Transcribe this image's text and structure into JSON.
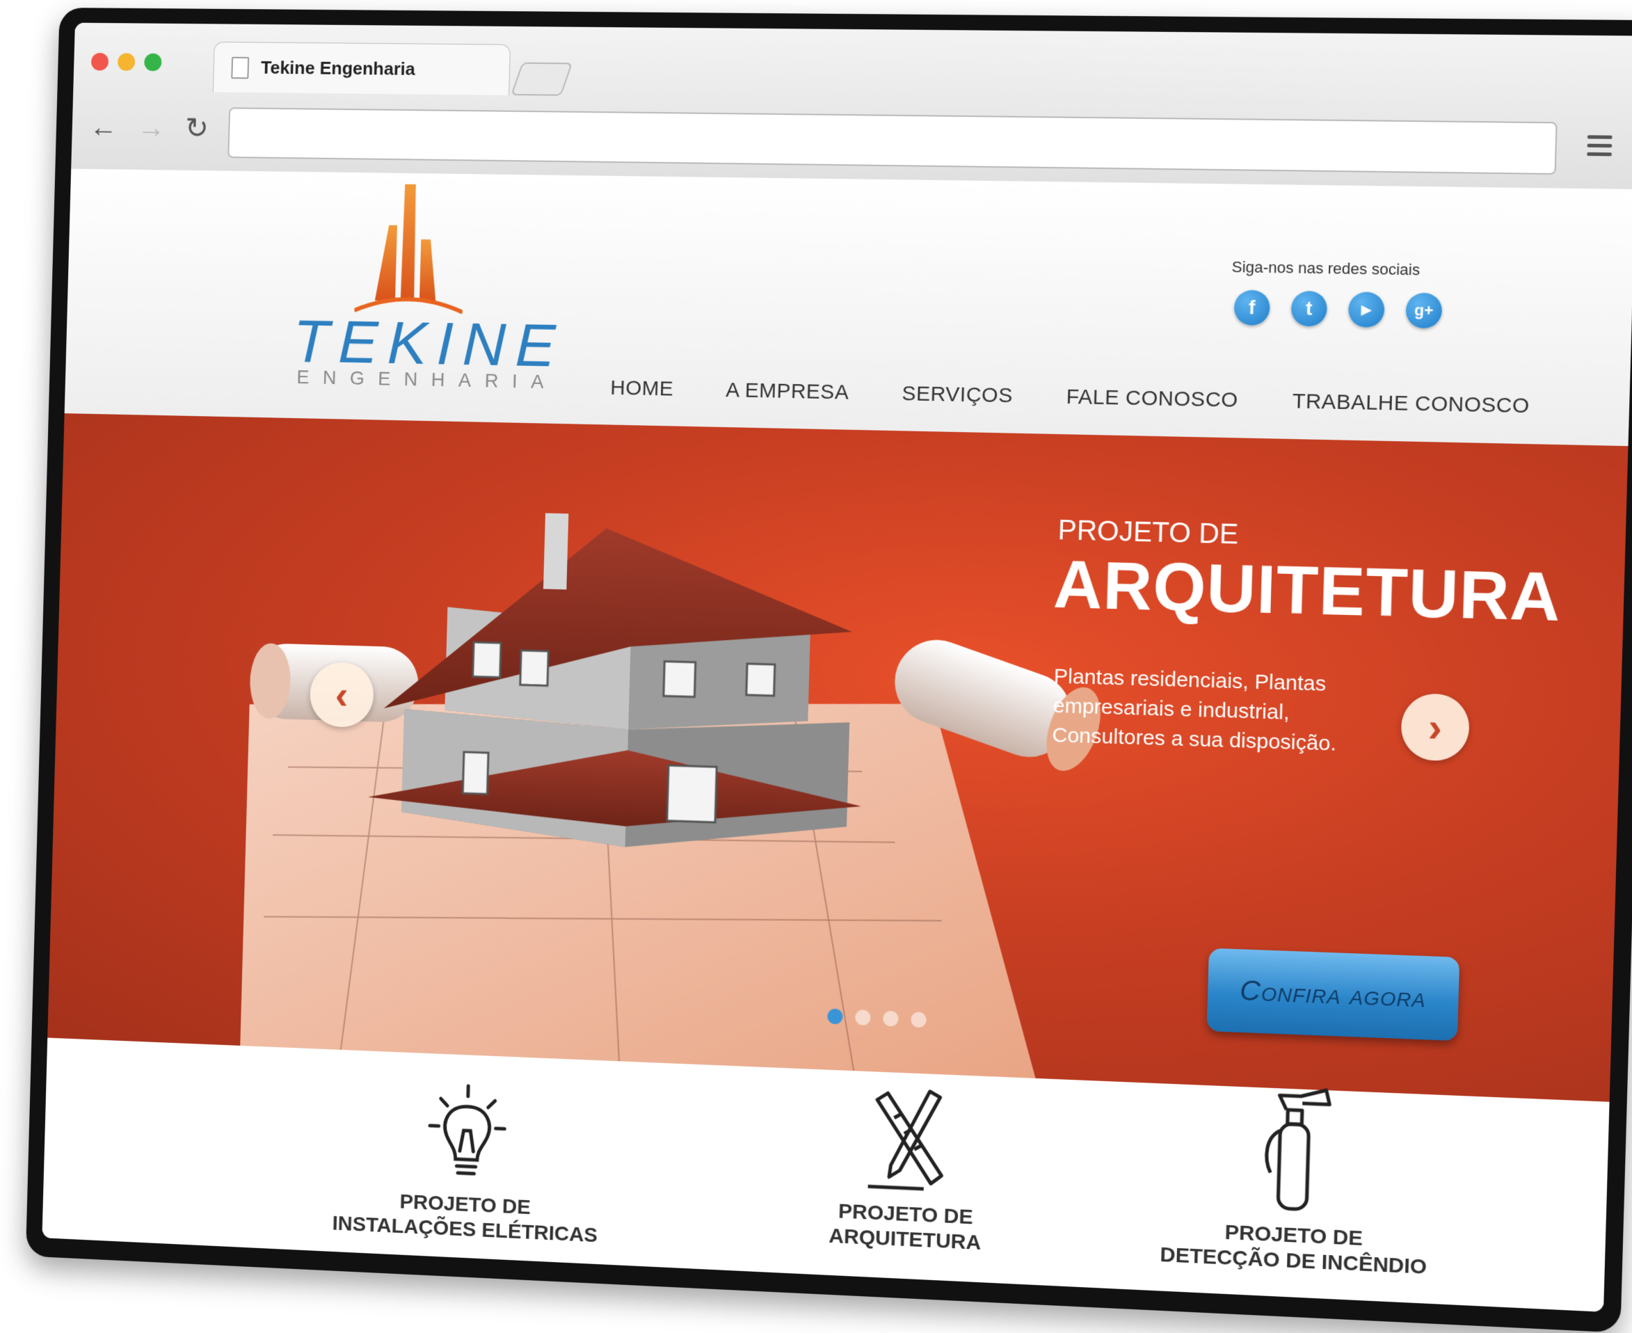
{
  "browser": {
    "tab_title": "Tekine Engenharia",
    "url": ""
  },
  "header": {
    "logo": {
      "name": "TEKINE",
      "sub": "ENGENHARIA"
    },
    "social_label": "Siga-nos nas redes sociais",
    "social": [
      "facebook-icon",
      "twitter-icon",
      "youtube-icon",
      "googleplus-icon"
    ],
    "nav": [
      "HOME",
      "A EMPRESA",
      "SERVIÇOS",
      "FALE CONOSCO",
      "TRABALHE CONOSCO"
    ]
  },
  "hero": {
    "kicker": "PROJETO DE",
    "title": "ARQUITETURA",
    "description": "Plantas residenciais, Plantas empresariais e industrial, Consultores a sua disposição.",
    "cta": "Confira agora",
    "slides": 4,
    "active_slide": 1
  },
  "services": [
    {
      "icon": "lightbulb-icon",
      "line1": "PROJETO DE",
      "line2": "INSTALAÇÕES ELÉTRICAS"
    },
    {
      "icon": "pencil-ruler-icon",
      "line1": "PROJETO DE",
      "line2": "ARQUITETURA"
    },
    {
      "icon": "fire-extinguisher-icon",
      "line1": "PROJETO DE",
      "line2": "DETECÇÃO DE INCÊNDIO"
    }
  ],
  "colors": {
    "hero_red": "#c73e22",
    "brand_blue": "#2d7fc0",
    "brand_orange": "#e8641f",
    "cta_blue": "#2a85c9"
  }
}
